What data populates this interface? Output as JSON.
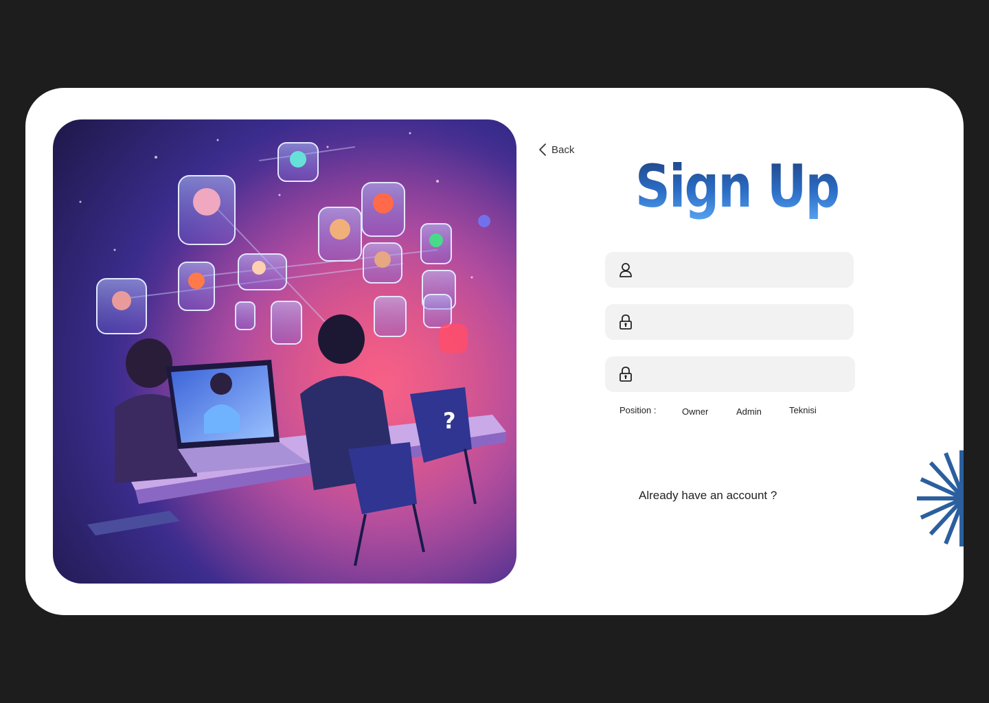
{
  "nav": {
    "back_label": "Back"
  },
  "form": {
    "title": "Sign Up",
    "username": {
      "value": "",
      "placeholder": ""
    },
    "password": {
      "value": "",
      "placeholder": ""
    },
    "confirm_password": {
      "value": "",
      "placeholder": ""
    },
    "position_label": "Position :",
    "positions": [
      "Owner",
      "Admin",
      "Teknisi"
    ],
    "already_account": "Already have an account ?"
  },
  "icons": {
    "back": "chevron-left-icon",
    "username": "user-icon",
    "password": "lock-icon",
    "confirm_password": "lock-icon",
    "decoration": "sunburst-icon"
  },
  "colors": {
    "background": "#1d1d1d",
    "card": "#ffffff",
    "field": "#f2f2f2",
    "title_dark": "#1f3f7a",
    "title_light": "#56a3f2",
    "accent": "#2b5f9e"
  }
}
